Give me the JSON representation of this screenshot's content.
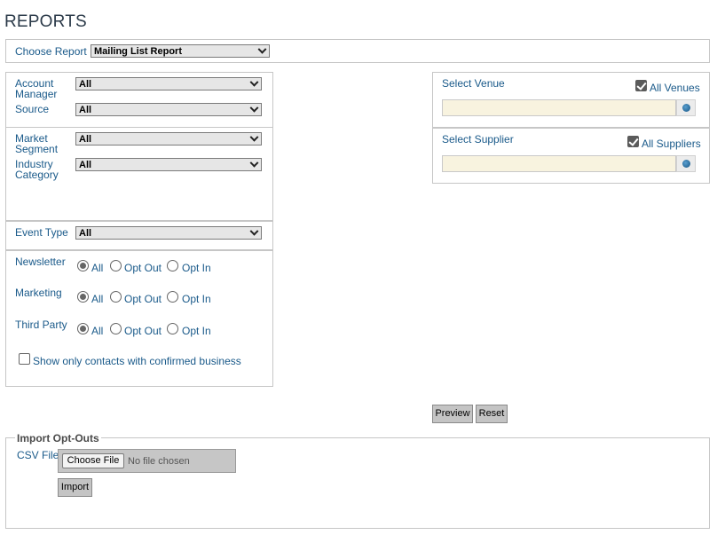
{
  "page": {
    "title": "REPORTS"
  },
  "report": {
    "label": "Choose Report",
    "selected": "Mailing List Report"
  },
  "filters": {
    "account_manager": {
      "label_line1": "Account",
      "label_line2": "Manager",
      "value": "All"
    },
    "source": {
      "label": "Source",
      "value": "All"
    },
    "market_segment": {
      "label_line1": "Market",
      "label_line2": "Segment",
      "value": "All"
    },
    "industry_category": {
      "label_line1": "Industry",
      "label_line2": "Category",
      "value": "All"
    },
    "event_type": {
      "label": "Event Type",
      "value": "All"
    }
  },
  "preferences": {
    "options": [
      "All",
      "Opt Out",
      "Opt In"
    ],
    "newsletter": {
      "label": "Newsletter",
      "selected": "All"
    },
    "marketing": {
      "label": "Marketing",
      "selected": "All"
    },
    "third_party": {
      "label": "Third Party",
      "selected": "All"
    },
    "confirmed_business": {
      "label": "Show only contacts with confirmed business",
      "checked": false
    }
  },
  "venue": {
    "label": "Select Venue",
    "all_label": "All Venues",
    "all_checked": true,
    "value": ""
  },
  "supplier": {
    "label": "Select Supplier",
    "all_label": "All Suppliers",
    "all_checked": true,
    "value": ""
  },
  "actions": {
    "preview": "Preview",
    "reset": "Reset"
  },
  "import": {
    "legend": "Import Opt-Outs",
    "csv_label": "CSV File",
    "choose_file": "Choose File",
    "no_file": "No file chosen",
    "import_button": "Import"
  },
  "colors": {
    "label_blue": "#1a5a8a",
    "field_cream": "#f8f3df",
    "button_gray": "#c4c4c4"
  },
  "icons": {
    "lookup": "globe-icon",
    "dropdown": "chevron-down-icon"
  }
}
